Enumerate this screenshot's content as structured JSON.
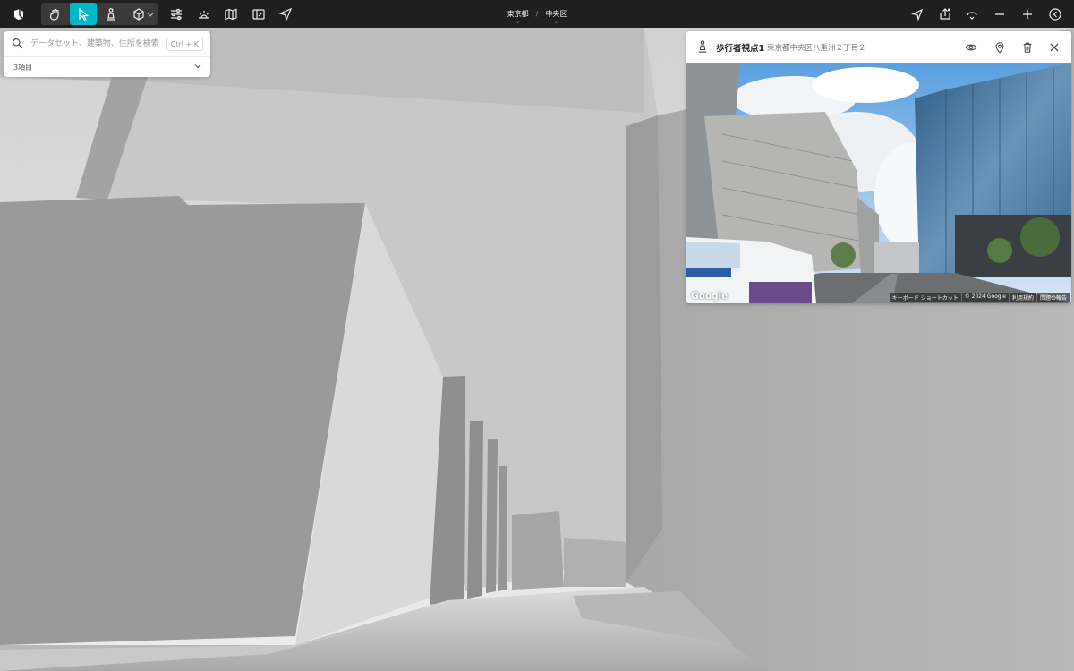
{
  "toolbar": {
    "breadcrumb": {
      "prefecture": "東京都",
      "separator": "/",
      "ward": "中央区"
    },
    "active_tool": "select"
  },
  "search": {
    "placeholder": "データセット、建築物、住所を検索",
    "shortcut": "Ctrl + K",
    "items_count": "3項目"
  },
  "pedestrian_panel": {
    "title": "歩行者視点1",
    "address": "東京都中央区八重洲２丁目２",
    "google_label": "Google",
    "attributions": [
      "キーボード ショートカット",
      "© 2024 Google",
      "利用規約",
      "問題の報告"
    ]
  },
  "colors": {
    "accent": "#00b8c8",
    "toolbar_bg": "#1f1f1f"
  }
}
